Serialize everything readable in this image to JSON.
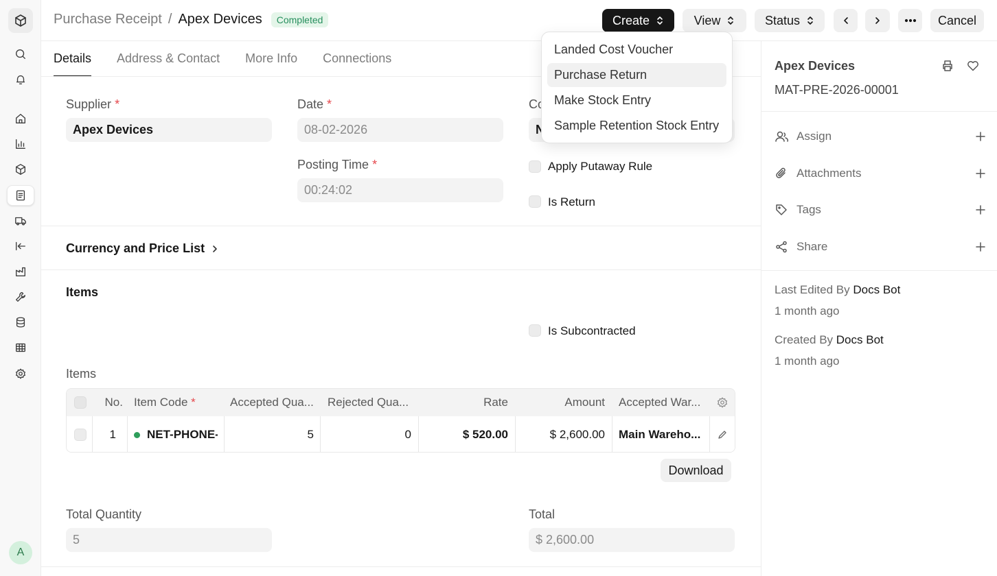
{
  "header": {
    "doctype": "Purchase Receipt",
    "separator": "/",
    "title": "Apex Devices",
    "status": "Completed",
    "create_label": "Create",
    "view_label": "View",
    "status_label": "Status",
    "cancel_label": "Cancel"
  },
  "create_menu": {
    "items": [
      "Landed Cost Voucher",
      "Purchase Return",
      "Make Stock Entry",
      "Sample Retention Stock Entry"
    ]
  },
  "tabs": [
    "Details",
    "Address & Contact",
    "More Info",
    "Connections"
  ],
  "form": {
    "supplier_label": "Supplier",
    "supplier_value": "Apex Devices",
    "date_label": "Date",
    "date_value": "08-02-2026",
    "posting_time_label": "Posting Time",
    "posting_time_value": "00:24:02",
    "company_label_partial": "Co",
    "company_value_partial": "N",
    "required_mark": "*",
    "apply_putaway_label": "Apply Putaway Rule",
    "is_return_label": "Is Return",
    "currency_section": "Currency and Price List",
    "items_section": "Items",
    "is_subcontracted_label": "Is Subcontracted",
    "items_table_label": "Items",
    "download_label": "Download",
    "total_qty_label": "Total Quantity",
    "total_qty_value": "5",
    "total_label": "Total",
    "total_value": "$ 2,600.00"
  },
  "items_table": {
    "columns": [
      "No.",
      "Item Code",
      "Accepted Qua...",
      "Rejected Qua...",
      "Rate",
      "Amount",
      "Accepted War..."
    ],
    "rows": [
      {
        "no": "1",
        "item_code": "NET-PHONE-",
        "accepted_qty": "5",
        "rejected_qty": "0",
        "rate": "$ 520.00",
        "amount": "$ 2,600.00",
        "warehouse": "Main Wareho..."
      }
    ]
  },
  "sidebar": {
    "title": "Apex Devices",
    "doc_id": "MAT-PRE-2026-00001",
    "actions": [
      "Assign",
      "Attachments",
      "Tags",
      "Share"
    ],
    "last_edited_prefix": "Last Edited By",
    "last_edited_by": "Docs Bot",
    "last_edited_when": "1 month ago",
    "created_prefix": "Created By",
    "created_by": "Docs Bot",
    "created_when": "1 month ago"
  },
  "user": {
    "avatar_initial": "A"
  },
  "colors": {
    "accent_dark": "#171717",
    "status_green": "#278f5e",
    "required_red": "#e5484d"
  }
}
